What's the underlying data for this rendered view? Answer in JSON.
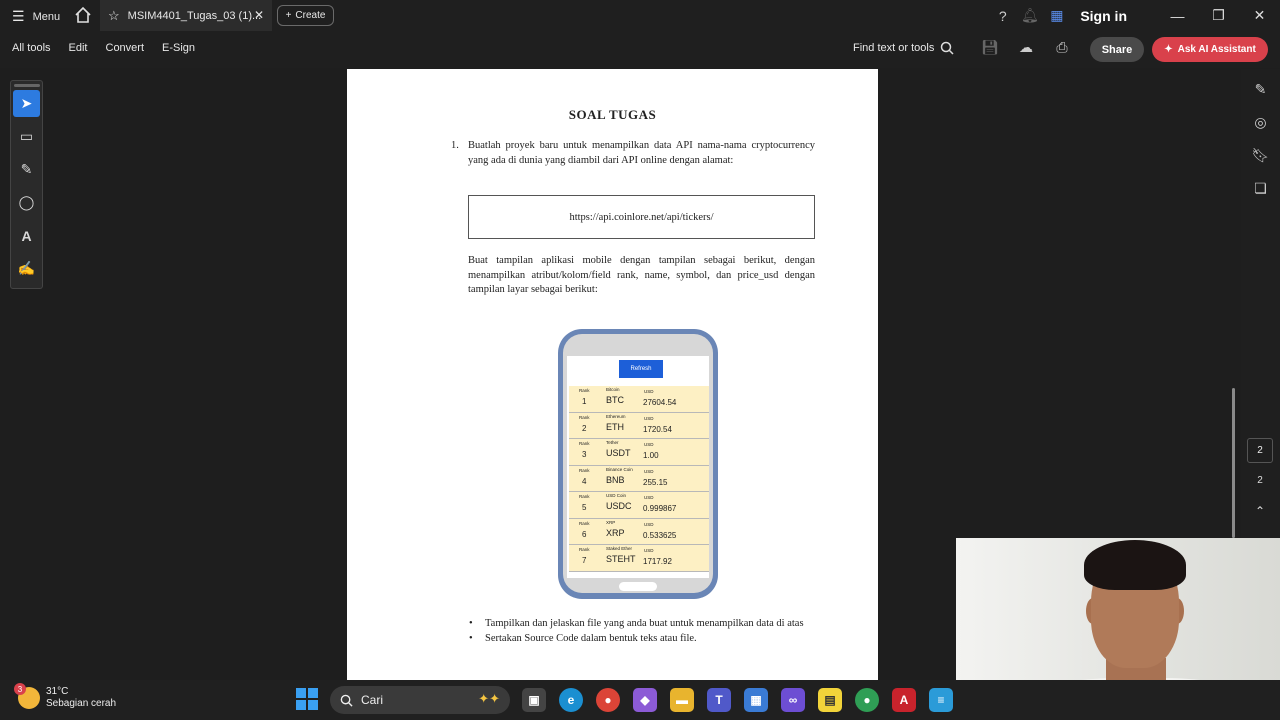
{
  "titlebar": {
    "menu_label": "Menu",
    "tab_title": "MSIM4401_Tugas_03 (1)...",
    "create_label": "Create",
    "signin_label": "Sign in"
  },
  "toolbar": {
    "all_tools": "All tools",
    "edit": "Edit",
    "convert": "Convert",
    "esign": "E-Sign",
    "find_label": "Find text or tools",
    "share_label": "Share",
    "ask_ai_label": "Ask AI Assistant"
  },
  "document": {
    "heading": "SOAL TUGAS",
    "q1_number": "1.",
    "q1_text": "Buatlah proyek baru untuk menampilkan data API nama-nama cryptocurrency yang ada di dunia yang diambil dari API online dengan alamat:",
    "api_url": "https://api.coinlore.net/api/tickers/",
    "paragraph2": "Buat tampilan aplikasi mobile dengan tampilan sebagai berikut, dengan menampilkan atribut/kolom/field rank, name, symbol, dan price_usd dengan tampilan layar sebagai berikut:",
    "bullets": [
      "Tampilkan dan jelaskan file yang anda buat untuk menampilkan data di atas",
      "Sertakan Source Code dalam bentuk teks atau file."
    ]
  },
  "phone_mockup": {
    "refresh_label": "Refresh",
    "rank_label": "Rank",
    "currency_label": "USD",
    "rows": [
      {
        "rank": "1",
        "name": "Bitcoin",
        "symbol": "BTC",
        "price": "27604.54"
      },
      {
        "rank": "2",
        "name": "Ethereum",
        "symbol": "ETH",
        "price": "1720.54"
      },
      {
        "rank": "3",
        "name": "Tether",
        "symbol": "USDT",
        "price": "1.00"
      },
      {
        "rank": "4",
        "name": "Binance Coin",
        "symbol": "BNB",
        "price": "255.15"
      },
      {
        "rank": "5",
        "name": "USD Coin",
        "symbol": "USDC",
        "price": "0.999867"
      },
      {
        "rank": "6",
        "name": "XRP",
        "symbol": "XRP",
        "price": "0.533625"
      },
      {
        "rank": "7",
        "name": "Staked Ether",
        "symbol": "STEHT",
        "price": "1717.92"
      }
    ]
  },
  "page_nav": {
    "current_page": "2",
    "total_pages": "2"
  },
  "taskbar": {
    "weather_badge": "3",
    "temperature": "31°C",
    "weather_desc": "Sebagian cerah",
    "search_label": "Cari"
  },
  "colors": {
    "accent_blue": "#2d7be0",
    "ask_ai_red": "#d9414b",
    "row_bg": "#fdf0c4",
    "phone_frame": "#6a86b6",
    "refresh_blue": "#1d5fd8"
  }
}
